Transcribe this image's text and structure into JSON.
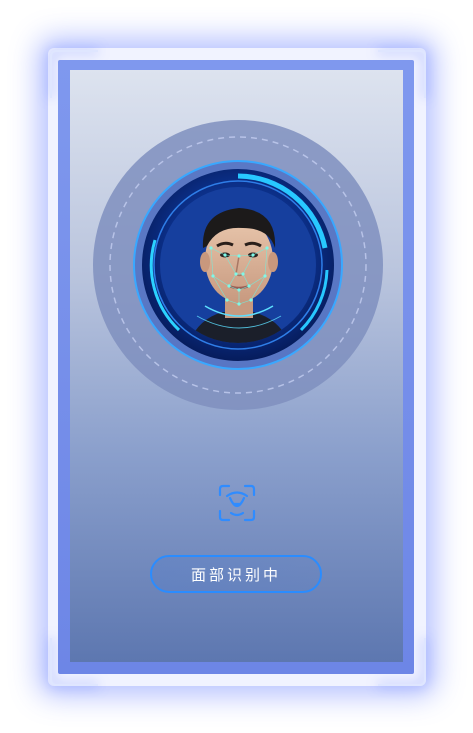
{
  "status": {
    "label": "面部识别中"
  },
  "icons": {
    "scan": "face-scan-icon",
    "portrait": "face-portrait"
  },
  "colors": {
    "frame_glow": "#6078ff",
    "accent": "#2a8cff",
    "ring_cyan": "#28c8ff",
    "panel_top": "#dde3ef",
    "panel_bottom": "#5d77b0"
  }
}
